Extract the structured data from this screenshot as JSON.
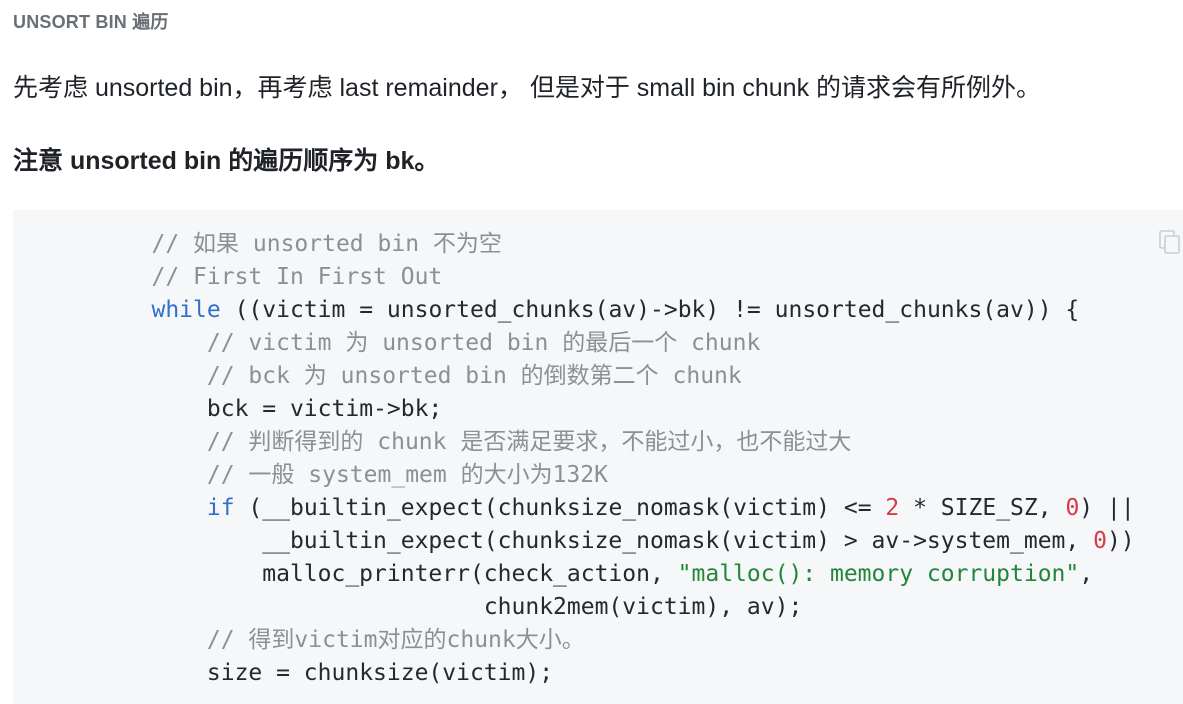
{
  "section_label": "UNSORT BIN 遍历",
  "paragraph": "先考虑 unsorted bin，再考虑 last remainder， 但是对于 small bin chunk 的请求会有所例外。",
  "paragraph_bold": "注意 unsorted bin 的遍历顺序为 bk。",
  "code_block": {
    "copy_icon": "copy-icon",
    "colors": {
      "background": "#f6f7f8",
      "comment": "#8a9096",
      "keyword": "#2f6fd0",
      "number": "#d73a49",
      "string": "#22863a",
      "plain": "#24292f"
    },
    "lines": [
      {
        "indent": "          ",
        "tokens": [
          {
            "t": "c",
            "v": "// 如果 unsorted bin 不为空"
          }
        ]
      },
      {
        "indent": "          ",
        "tokens": [
          {
            "t": "c",
            "v": "// First In First Out"
          }
        ]
      },
      {
        "indent": "          ",
        "tokens": [
          {
            "t": "k",
            "v": "while"
          },
          {
            "t": "p",
            "v": " ((victim = unsorted_chunks(av)->bk) != unsorted_chunks(av)) {"
          }
        ]
      },
      {
        "indent": "              ",
        "tokens": [
          {
            "t": "c",
            "v": "// victim 为 unsorted bin 的最后一个 chunk"
          }
        ]
      },
      {
        "indent": "              ",
        "tokens": [
          {
            "t": "c",
            "v": "// bck 为 unsorted bin 的倒数第二个 chunk"
          }
        ]
      },
      {
        "indent": "              ",
        "tokens": [
          {
            "t": "p",
            "v": "bck = victim->bk;"
          }
        ]
      },
      {
        "indent": "              ",
        "tokens": [
          {
            "t": "c",
            "v": "// 判断得到的 chunk 是否满足要求，不能过小，也不能过大"
          }
        ]
      },
      {
        "indent": "              ",
        "tokens": [
          {
            "t": "c",
            "v": "// 一般 system_mem 的大小为132K"
          }
        ]
      },
      {
        "indent": "              ",
        "tokens": [
          {
            "t": "k",
            "v": "if"
          },
          {
            "t": "p",
            "v": " (__builtin_expect(chunksize_nomask(victim) <= "
          },
          {
            "t": "n",
            "v": "2"
          },
          {
            "t": "p",
            "v": " * SIZE_SZ, "
          },
          {
            "t": "n",
            "v": "0"
          },
          {
            "t": "p",
            "v": ") ||"
          }
        ]
      },
      {
        "indent": "                  ",
        "tokens": [
          {
            "t": "p",
            "v": "__builtin_expect(chunksize_nomask(victim) > av->system_mem, "
          },
          {
            "t": "n",
            "v": "0"
          },
          {
            "t": "p",
            "v": "))"
          }
        ]
      },
      {
        "indent": "                  ",
        "tokens": [
          {
            "t": "p",
            "v": "malloc_printerr(check_action, "
          },
          {
            "t": "s",
            "v": "\"malloc(): memory corruption\""
          },
          {
            "t": "p",
            "v": ","
          }
        ]
      },
      {
        "indent": "                                  ",
        "tokens": [
          {
            "t": "p",
            "v": "chunk2mem(victim), av);"
          }
        ]
      },
      {
        "indent": "              ",
        "tokens": [
          {
            "t": "c",
            "v": "// 得到victim对应的chunk大小。"
          }
        ]
      },
      {
        "indent": "              ",
        "tokens": [
          {
            "t": "p",
            "v": "size = chunksize(victim);"
          }
        ]
      }
    ]
  }
}
